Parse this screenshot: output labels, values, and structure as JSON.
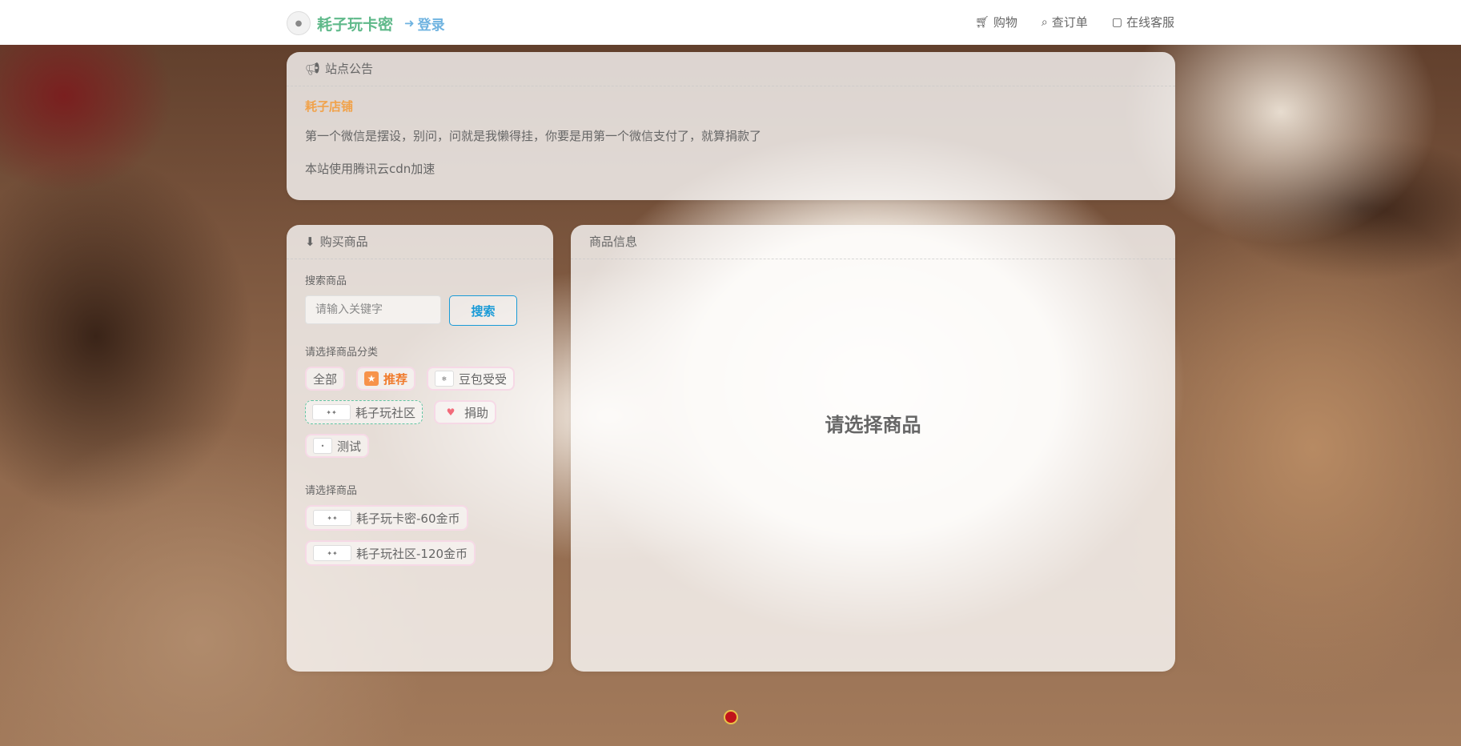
{
  "header": {
    "brand_title": "耗子玩卡密",
    "login_label": "登录",
    "nav": [
      {
        "label": "购物",
        "icon": "cart-icon"
      },
      {
        "label": "查订单",
        "icon": "search-order-icon"
      },
      {
        "label": "在线客服",
        "icon": "chat-icon"
      }
    ]
  },
  "notice": {
    "title": "站点公告",
    "shop_name": "耗子店铺",
    "lines": [
      "第一个微信是摆设，别问，问就是我懒得挂，你要是用第一个微信支付了，就算捐款了",
      "本站使用腾讯云cdn加速"
    ]
  },
  "buy": {
    "title": "购买商品",
    "search_label": "搜索商品",
    "search_placeholder": "请输入关键字",
    "search_button": "搜索",
    "category_label": "请选择商品分类",
    "categories": [
      {
        "label": "全部",
        "icon": "none"
      },
      {
        "label": "推荐",
        "icon": "star-icon"
      },
      {
        "label": "豆包受受",
        "icon": "category-image-icon"
      },
      {
        "label": "耗子玩社区",
        "icon": "category-image-icon"
      },
      {
        "label": "捐助",
        "icon": "heart-icon"
      },
      {
        "label": "测试",
        "icon": "category-image-icon"
      }
    ],
    "goods_label": "请选择商品",
    "goods": [
      "耗子玩卡密-60金币",
      "耗子玩社区-120金币"
    ]
  },
  "info": {
    "title": "商品信息",
    "empty_text": "请选择商品"
  },
  "colors": {
    "brand": "#5fb98a",
    "login": "#6fb3e0",
    "shop_name": "#f1a24a",
    "search_button": "#1a9bd7",
    "hot_category": "#f07b2c",
    "active_border": "#63c6a4"
  }
}
